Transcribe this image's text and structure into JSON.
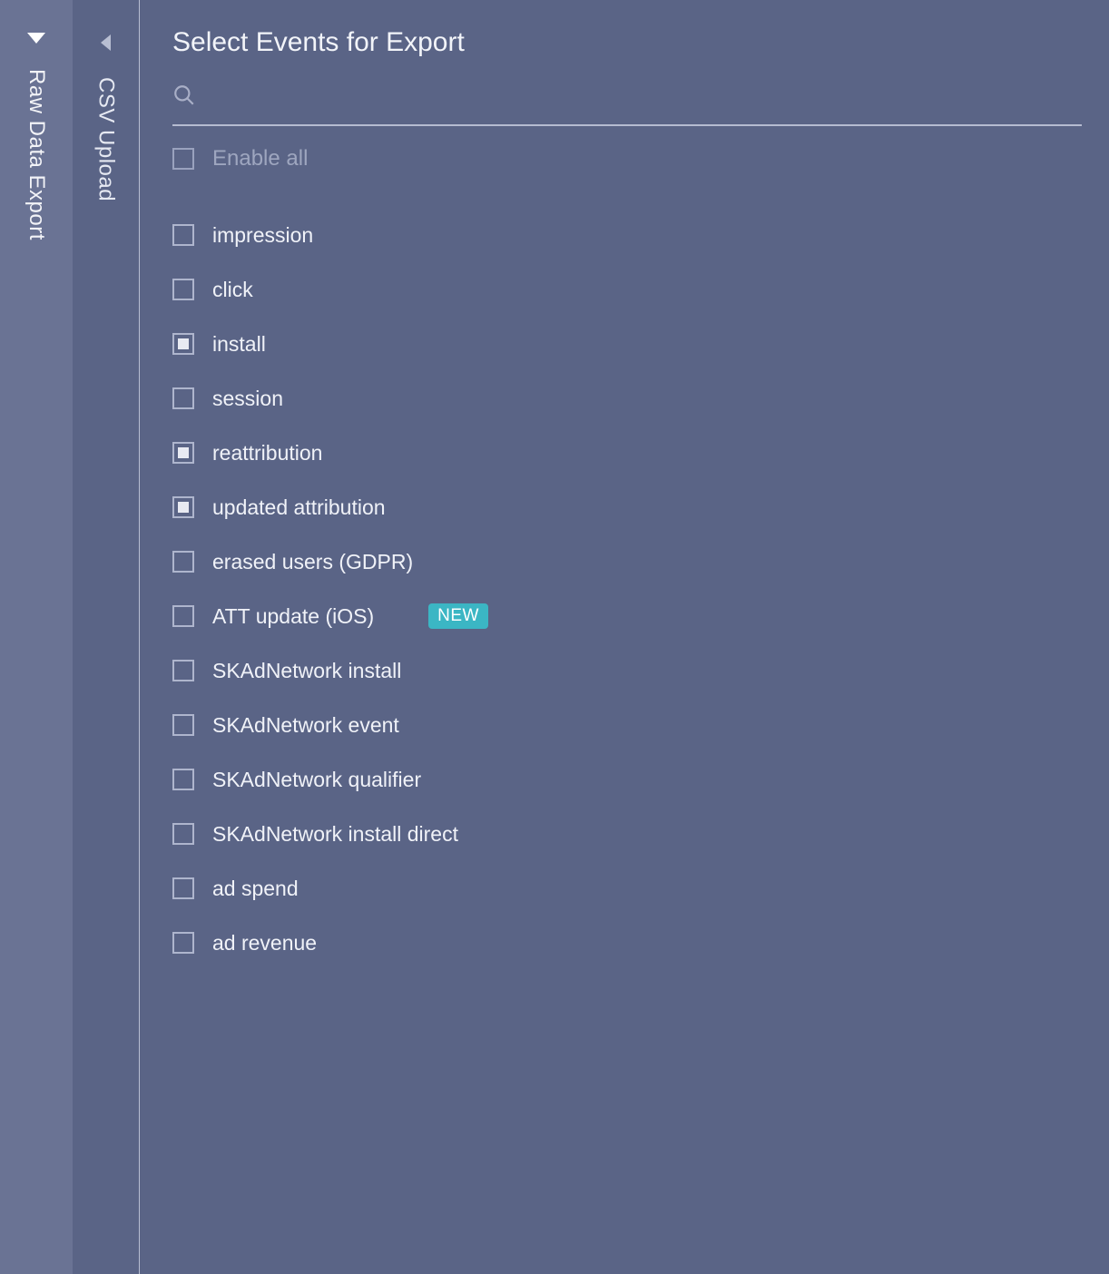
{
  "rails": {
    "outer_label": "Raw Data Export",
    "inner_label": "CSV Upload"
  },
  "main": {
    "title": "Select Events for Export",
    "search_placeholder": "",
    "enable_all_label": "Enable all",
    "badge_text": "NEW",
    "events": [
      {
        "label": "impression",
        "checked": false,
        "badge": false
      },
      {
        "label": "click",
        "checked": false,
        "badge": false
      },
      {
        "label": "install",
        "checked": true,
        "badge": false
      },
      {
        "label": "session",
        "checked": false,
        "badge": false
      },
      {
        "label": "reattribution",
        "checked": true,
        "badge": false
      },
      {
        "label": "updated attribution",
        "checked": true,
        "badge": false
      },
      {
        "label": "erased users (GDPR)",
        "checked": false,
        "badge": false
      },
      {
        "label": "ATT update (iOS)",
        "checked": false,
        "badge": true
      },
      {
        "label": "SKAdNetwork install",
        "checked": false,
        "badge": false
      },
      {
        "label": "SKAdNetwork event",
        "checked": false,
        "badge": false
      },
      {
        "label": "SKAdNetwork qualifier",
        "checked": false,
        "badge": false
      },
      {
        "label": "SKAdNetwork install direct",
        "checked": false,
        "badge": false
      },
      {
        "label": "ad spend",
        "checked": false,
        "badge": false
      },
      {
        "label": "ad revenue",
        "checked": false,
        "badge": false
      }
    ]
  }
}
